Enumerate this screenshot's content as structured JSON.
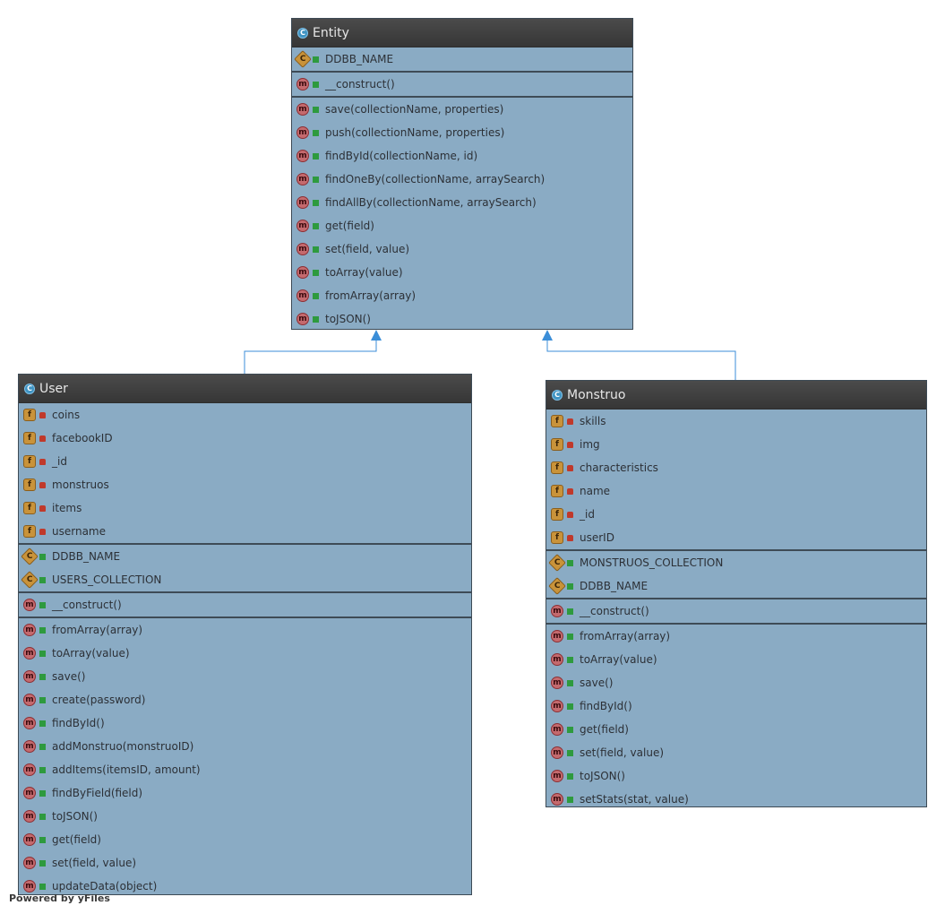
{
  "entity": {
    "name": "Entity",
    "constants": [
      "DDBB_NAME"
    ],
    "constructors": [
      "__construct()"
    ],
    "methods": [
      "save(collectionName, properties)",
      "push(collectionName, properties)",
      "findById(collectionName, id)",
      "findOneBy(collectionName, arraySearch)",
      "findAllBy(collectionName, arraySearch)",
      "get(field)",
      "set(field, value)",
      "toArray(value)",
      "fromArray(array)",
      "toJSON()"
    ]
  },
  "user": {
    "name": "User",
    "fields": [
      "coins",
      "facebookID",
      "_id",
      "monstruos",
      "items",
      "username"
    ],
    "constants": [
      "DDBB_NAME",
      "USERS_COLLECTION"
    ],
    "constructors": [
      "__construct()"
    ],
    "methods": [
      "fromArray(array)",
      "toArray(value)",
      "save()",
      "create(password)",
      "findById()",
      "addMonstruo(monstruoID)",
      "addItems(itemsID, amount)",
      "findByField(field)",
      "toJSON()",
      "get(field)",
      "set(field, value)",
      "updateData(object)"
    ]
  },
  "monstruo": {
    "name": "Monstruo",
    "fields": [
      "skills",
      "img",
      "characteristics",
      "name",
      "_id",
      "userID"
    ],
    "constants": [
      "MONSTRUOS_COLLECTION",
      "DDBB_NAME"
    ],
    "constructors": [
      "__construct()"
    ],
    "methods": [
      "fromArray(array)",
      "toArray(value)",
      "save()",
      "findById()",
      "get(field)",
      "set(field, value)",
      "toJSON()",
      "setStats(stat, value)"
    ]
  },
  "icons": {
    "class": "C",
    "field": "f",
    "method": "m",
    "constant": "C"
  },
  "watermark": "Powered by yFiles"
}
